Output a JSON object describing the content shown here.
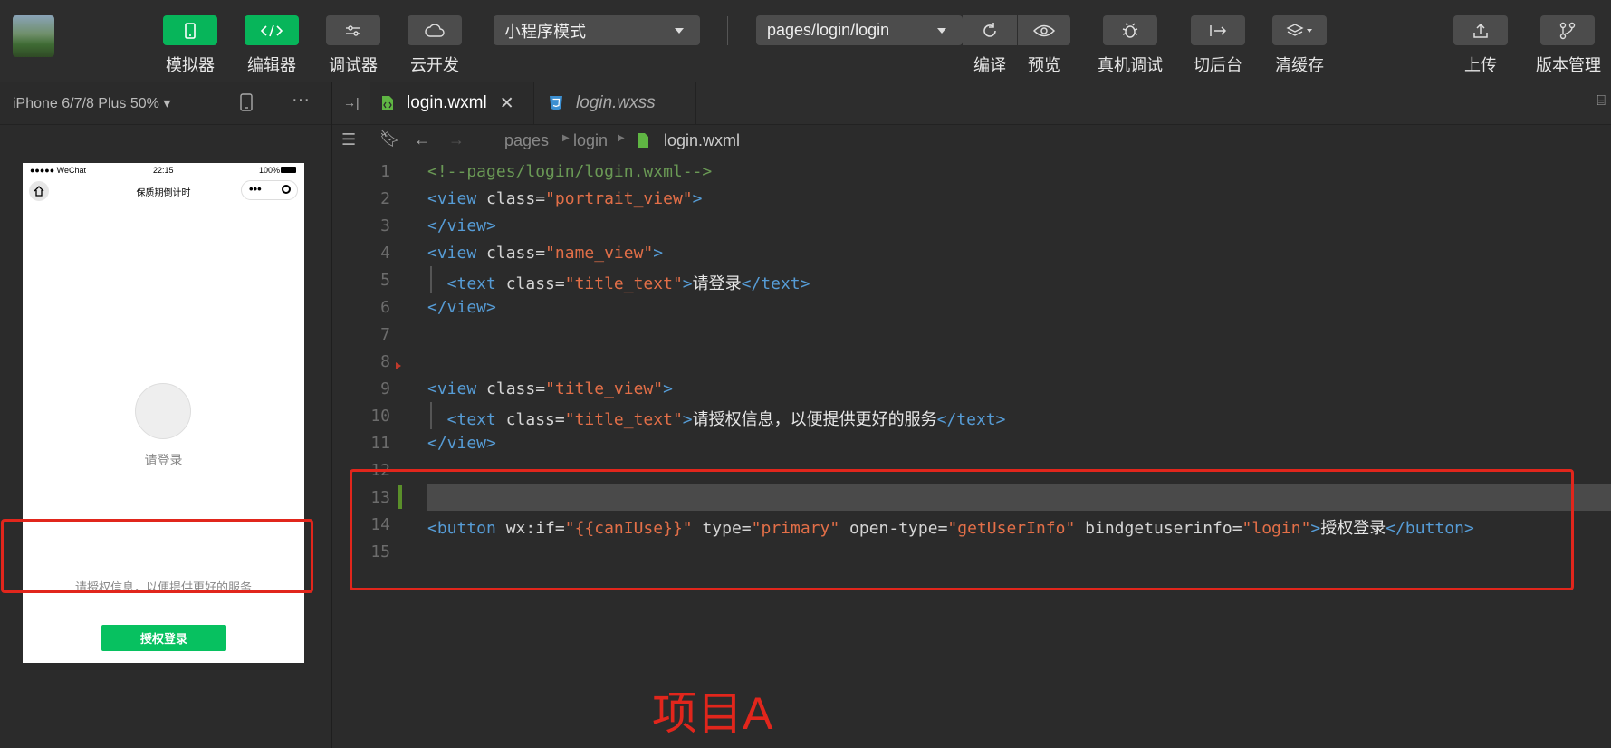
{
  "toolbar": {
    "buttons": [
      {
        "label": "模拟器",
        "icon": "phone-icon"
      },
      {
        "label": "编辑器",
        "icon": "code-icon"
      },
      {
        "label": "调试器",
        "icon": "sliders-icon"
      },
      {
        "label": "云开发",
        "icon": "cloud-icon"
      }
    ],
    "mode_select": "小程序模式",
    "page_select": "pages/login/login",
    "compile": "编译",
    "preview": "预览",
    "remote_debug": "真机调试",
    "background": "切后台",
    "clear_cache": "清缓存",
    "upload": "上传",
    "version": "版本管理"
  },
  "simulator": {
    "device": "iPhone 6/7/8 Plus 50%",
    "status_carrier": "●●●●● WeChat",
    "status_time": "22:15",
    "status_battery": "100%",
    "nav_title": "保质期倒计时",
    "login_prompt": "请登录",
    "auth_text": "请授权信息，以便提供更好的服务",
    "auth_button": "授权登录"
  },
  "editor": {
    "tabs": [
      {
        "label": "login.wxml",
        "active": true
      },
      {
        "label": "login.wxss",
        "active": false
      }
    ],
    "breadcrumb": [
      "pages",
      "login",
      "login.wxml"
    ],
    "lines": [
      {
        "n": "1",
        "parts": [
          [
            "cmt",
            "<!--pages/login/login.wxml-->"
          ]
        ]
      },
      {
        "n": "2",
        "parts": [
          [
            "tag",
            "<view "
          ],
          [
            "attr",
            "class="
          ],
          [
            "str",
            "\"portrait_view\""
          ],
          [
            "tag",
            ">"
          ]
        ]
      },
      {
        "n": "3",
        "parts": [
          [
            "tag",
            "</view>"
          ]
        ]
      },
      {
        "n": "4",
        "parts": [
          [
            "tag",
            "<view "
          ],
          [
            "attr",
            "class="
          ],
          [
            "str",
            "\"name_view\""
          ],
          [
            "tag",
            ">"
          ]
        ]
      },
      {
        "n": "5",
        "parts": [
          [
            "tag",
            "  <text "
          ],
          [
            "attr",
            "class="
          ],
          [
            "str",
            "\"title_text\""
          ],
          [
            "tag",
            ">"
          ],
          [
            "txt",
            "请登录"
          ],
          [
            "tag",
            "</text>"
          ]
        ]
      },
      {
        "n": "6",
        "parts": [
          [
            "tag",
            "</view>"
          ]
        ]
      },
      {
        "n": "7",
        "parts": []
      },
      {
        "n": "8",
        "parts": []
      },
      {
        "n": "9",
        "parts": [
          [
            "tag",
            "<view "
          ],
          [
            "attr",
            "class="
          ],
          [
            "str",
            "\"title_view\""
          ],
          [
            "tag",
            ">"
          ]
        ]
      },
      {
        "n": "10",
        "parts": [
          [
            "tag",
            "  <text "
          ],
          [
            "attr",
            "class="
          ],
          [
            "str",
            "\"title_text\""
          ],
          [
            "tag",
            ">"
          ],
          [
            "txt",
            "请授权信息，以便提供更好的服务"
          ],
          [
            "tag",
            "</text>"
          ]
        ]
      },
      {
        "n": "11",
        "parts": [
          [
            "tag",
            "</view>"
          ]
        ]
      },
      {
        "n": "12",
        "parts": []
      },
      {
        "n": "13",
        "parts": []
      },
      {
        "n": "14",
        "parts": [
          [
            "tag",
            "<button "
          ],
          [
            "attr",
            "wx:if="
          ],
          [
            "str",
            "\"{{canIUse}}\""
          ],
          [
            "attr",
            " type="
          ],
          [
            "str",
            "\"primary\""
          ],
          [
            "attr",
            " open-type="
          ],
          [
            "str",
            "\"getUserInfo\""
          ],
          [
            "attr",
            " bindgetuserinfo="
          ],
          [
            "str",
            "\"login\""
          ],
          [
            "tag",
            ">"
          ],
          [
            "txt",
            "授权登录"
          ],
          [
            "tag",
            "</button>"
          ]
        ]
      },
      {
        "n": "15",
        "parts": []
      }
    ]
  },
  "annotation": "项目A",
  "colors": {
    "accent_green": "#07c160",
    "highlight_red": "#e1261c",
    "editor_bg": "#2b2b2b"
  }
}
